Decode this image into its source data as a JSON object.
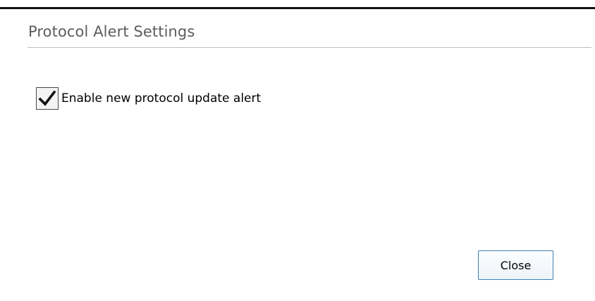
{
  "dialog": {
    "title": "Protocol Alert Settings"
  },
  "settings": {
    "alert_checkbox": {
      "label": "Enable new protocol update alert",
      "checked": true
    }
  },
  "actions": {
    "close_label": "Close"
  },
  "colors": {
    "title_text": "#5d5d5d",
    "button_border": "#3c7fb1",
    "top_border": "#111111"
  },
  "icons": {
    "checkbox_mark": "checkmark-icon"
  }
}
